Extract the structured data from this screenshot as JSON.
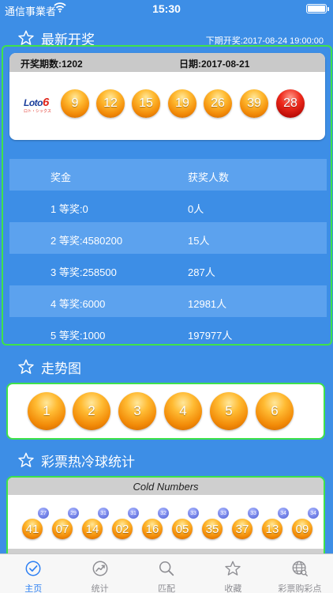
{
  "status_bar": {
    "carrier": "通信事業者",
    "time": "15:30"
  },
  "latest": {
    "title": "最新开奖",
    "next_draw": "下期开奖:2017-08-24 19:00:00",
    "period_label": "开奖期数:1202",
    "date_label": "日期:2017-08-21",
    "logo_text": "Loto",
    "logo_number": "6",
    "logo_sub": "ロト・シックス",
    "main_numbers": [
      "9",
      "12",
      "15",
      "19",
      "26",
      "39"
    ],
    "bonus_number": "28"
  },
  "prize_table": {
    "header": [
      "奖金",
      "获奖人数"
    ],
    "rows": [
      [
        "1 等奖:0",
        "0人"
      ],
      [
        "2 等奖:4580200",
        "15人"
      ],
      [
        "3 等奖:258500",
        "287人"
      ],
      [
        "4 等奖:6000",
        "12981人"
      ],
      [
        "5 等奖:1000",
        "197977人"
      ]
    ]
  },
  "trend": {
    "title": "走势图",
    "numbers": [
      "1",
      "2",
      "3",
      "4",
      "5",
      "6"
    ]
  },
  "hotcold": {
    "title": "彩票热冷球统计",
    "cold_title": "Cold Numbers",
    "balls": [
      {
        "number": "41",
        "count": "27"
      },
      {
        "number": "07",
        "count": "29"
      },
      {
        "number": "14",
        "count": "31"
      },
      {
        "number": "02",
        "count": "31"
      },
      {
        "number": "16",
        "count": "32"
      },
      {
        "number": "05",
        "count": "33"
      },
      {
        "number": "35",
        "count": "33"
      },
      {
        "number": "37",
        "count": "33"
      },
      {
        "number": "13",
        "count": "34"
      },
      {
        "number": "09",
        "count": "34"
      }
    ]
  },
  "tabs": [
    "主页",
    "统计",
    "匹配",
    "收藏",
    "彩票购彩点"
  ],
  "colors": {
    "background": "#3d8ee6",
    "panel_border": "#3fe24a",
    "tab_active": "#2c7ff3",
    "tab_inactive": "#8e8e93"
  }
}
